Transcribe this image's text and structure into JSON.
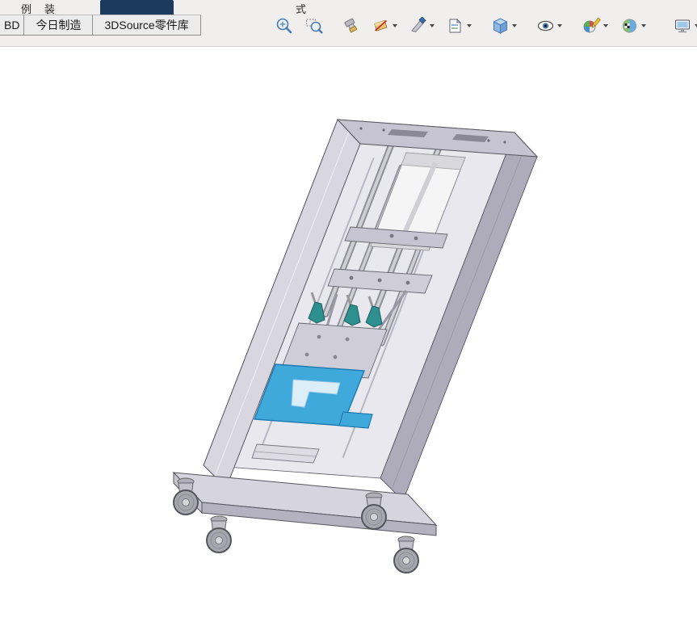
{
  "colors": {
    "header_bg": "#f0efee",
    "tab_bg": "#ececec",
    "tab_border": "#8f8f8f",
    "tab_text": "#1a1a1a",
    "selected_tab_bg": "#1c3a5e",
    "viewport_bg": "#ffffff",
    "edge": "#55555f",
    "frame_light": "#d8d6e0",
    "frame_mid": "#c6c4d0",
    "frame_dark": "#aeacba",
    "frame_inner": "#e9e8ef",
    "rod_dark": "#8f8f98",
    "rod_light": "#cfcfd6",
    "cylinder_body": "#f5f5f5",
    "plate_gray": "#cfcdd8",
    "teal": "#2e8f8f",
    "teal_edge": "#1c5f62",
    "blue_plate": "#3fa9dc",
    "blue_edge": "#1d7ab0",
    "base_top": "#d6d4de",
    "base_front": "#b4b2be",
    "wheel": "#a6a6ae",
    "wheel_rim": "#55555d",
    "icon_blue": "#4a7ab5"
  },
  "top_strip": {
    "fragment_left_1": "例",
    "fragment_left_2": "装",
    "fragment_right": "式"
  },
  "tabs": [
    {
      "label": "BD"
    },
    {
      "label": "今日制造"
    },
    {
      "label": "3DSource零件库"
    }
  ],
  "toolbar": {
    "buttons": [
      {
        "name": "zoom-to-fit",
        "dropdown": false
      },
      {
        "name": "zoom-to-area",
        "dropdown": false
      },
      {
        "name": "previous-view",
        "dropdown": false
      },
      {
        "name": "section-view",
        "dropdown": true
      },
      {
        "name": "3d-drawing-view",
        "dropdown": true
      },
      {
        "name": "new-view",
        "dropdown": true
      },
      {
        "name": "view-orientation",
        "dropdown": true
      },
      {
        "name": "hide-show-items",
        "dropdown": true
      },
      {
        "name": "edit-appearance",
        "dropdown": true
      },
      {
        "name": "apply-scene",
        "dropdown": true
      },
      {
        "name": "view-settings",
        "dropdown": true
      }
    ]
  }
}
